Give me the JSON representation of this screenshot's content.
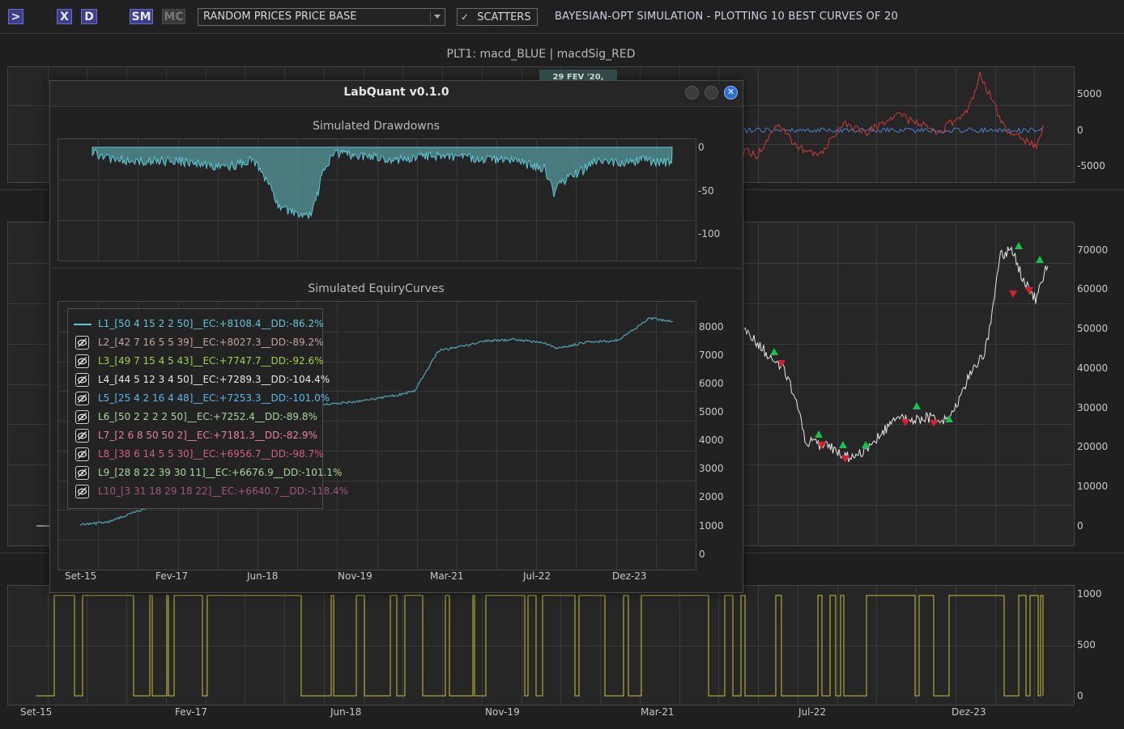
{
  "toolbar": {
    "run_label": ">",
    "x_label": "X",
    "d_label": "D",
    "sm_label": "SM",
    "mc_label": "MC",
    "asset_select_value": "RANDOM PRICES PRICE BASE",
    "scatters_check": "✓",
    "scatters_label": "SCATTERS",
    "title": "BAYESIAN-OPT SIMULATION - PLOTTING 10 BEST CURVES OF 20"
  },
  "plot1": {
    "title": "PLT1: macd_BLUE | macdSig_RED",
    "cursor_label": "29 FEV '20, 19:02",
    "yticks": [
      "5000",
      "0",
      "-5000"
    ],
    "colors": {
      "macd": "#4a7fd0",
      "signal": "#d23a3a"
    }
  },
  "plot2": {
    "yticks": [
      "70000",
      "60000",
      "50000",
      "40000",
      "30000",
      "20000",
      "10000",
      "0"
    ],
    "colors": {
      "price": "#e8e8e8",
      "buy": "#19c24a",
      "sell": "#d61f2e"
    }
  },
  "plot3": {
    "yticks": [
      "1000",
      "500",
      "0"
    ],
    "xticks": [
      "Set-15",
      "Fev-17",
      "Jun-18",
      "Nov-19",
      "Mar-21",
      "Jul-22",
      "Dez-23"
    ],
    "colors": {
      "position": "#c9c13a"
    }
  },
  "dialog": {
    "title": "LabQuant v0.1.0",
    "close_glyph": "✕",
    "drawdowns": {
      "title": "Simulated Drawdowns",
      "yticks": [
        "0",
        "-50",
        "-100"
      ]
    },
    "equity": {
      "title": "Simulated EquiryCurves",
      "yticks": [
        "8000",
        "7000",
        "6000",
        "5000",
        "4000",
        "3000",
        "2000",
        "1000",
        "0"
      ],
      "xticks": [
        "Set-15",
        "Fev-17",
        "Jun-18",
        "Nov-19",
        "Mar-21",
        "Jul-22",
        "Dez-23"
      ]
    },
    "legend": [
      {
        "label": "L1_[50 4 15 2 2 50]__EC:+8108.4__DD:-86.2%",
        "color": "#5fc7d6",
        "visible": true
      },
      {
        "label": "L2_[42 7 16 5 5 39]__EC:+8027.3__DD:-89.2%",
        "color": "#c4a3a3",
        "visible": false
      },
      {
        "label": "L3_[49 7 15 4 5 43]__EC:+7747.7__DD:-92.6%",
        "color": "#9ed34a",
        "visible": false
      },
      {
        "label": "L4_[44 5 12 3 4 50]__EC:+7289.3__DD:-104.4%",
        "color": "#e8e8e8",
        "visible": false
      },
      {
        "label": "L5_[25 4 2 16 4 48]__EC:+7253.3__DD:-101.0%",
        "color": "#5ab8ea",
        "visible": false
      },
      {
        "label": "L6_[50 2 2 2 2 50]__EC:+7252.4__DD:-89.8%",
        "color": "#a6d89a",
        "visible": false
      },
      {
        "label": "L7_[2 6 8 50 50 2]__EC:+7181.3__DD:-82.9%",
        "color": "#e77fa4",
        "visible": false
      },
      {
        "label": "L8_[38 6 14 5 5 30]__EC:+6956.7__DD:-98.7%",
        "color": "#d25f86",
        "visible": false
      },
      {
        "label": "L9_[28 8 22 39 30 11]__EC:+6676.9__DD:-101.1%",
        "color": "#a8d89c",
        "visible": false
      },
      {
        "label": "L10_[3 31 18 29 18 22]__EC:+6640.7__DD:-118.4%",
        "color": "#a0567a",
        "visible": false
      }
    ]
  },
  "chart_data": [
    {
      "type": "area",
      "title": "Simulated Drawdowns",
      "x": [
        "Set-15",
        "Fev-17",
        "Jun-18",
        "Nov-19",
        "Mar-21",
        "Jul-22",
        "Dez-23"
      ],
      "series": [
        {
          "name": "L1",
          "values": [
            -5,
            -15,
            -75,
            -12,
            -12,
            -45,
            -12
          ]
        }
      ],
      "ylim": [
        -130,
        10
      ]
    },
    {
      "type": "line",
      "title": "Simulated EquiryCurves",
      "x": [
        "Set-15",
        "Fev-17",
        "Jun-18",
        "Nov-19",
        "Mar-21",
        "Jul-22",
        "Dez-23"
      ],
      "series": [
        {
          "name": "L1_[50 4 15 2 2 50]__EC:+8108.4__DD:-86.2%",
          "values": [
            1000,
            1800,
            4200,
            5200,
            7400,
            7100,
            8100
          ]
        }
      ],
      "ylim": [
        0,
        8500
      ]
    },
    {
      "type": "line",
      "title": "PLT1: macd_BLUE | macdSig_RED",
      "x": [
        "Jul-22",
        "Dez-23"
      ],
      "series": [
        {
          "name": "macd",
          "values": [
            0,
            300
          ]
        },
        {
          "name": "macdSig",
          "values": [
            -2000,
            7500
          ]
        }
      ],
      "ylim": [
        -6000,
        8000
      ]
    },
    {
      "type": "line",
      "x": [
        "Jul-22",
        "Dez-23"
      ],
      "series": [
        {
          "name": "price",
          "values": [
            20000,
            70000
          ]
        }
      ],
      "ylim": [
        -5000,
        75000
      ]
    },
    {
      "type": "line",
      "x": [
        "Set-15",
        "Fev-17",
        "Jun-18",
        "Nov-19",
        "Mar-21",
        "Jul-22",
        "Dez-23"
      ],
      "series": [
        {
          "name": "position",
          "values": [
            0,
            1000,
            0,
            1000,
            0,
            1000,
            0
          ]
        }
      ],
      "ylim": [
        -100,
        1100
      ]
    }
  ]
}
